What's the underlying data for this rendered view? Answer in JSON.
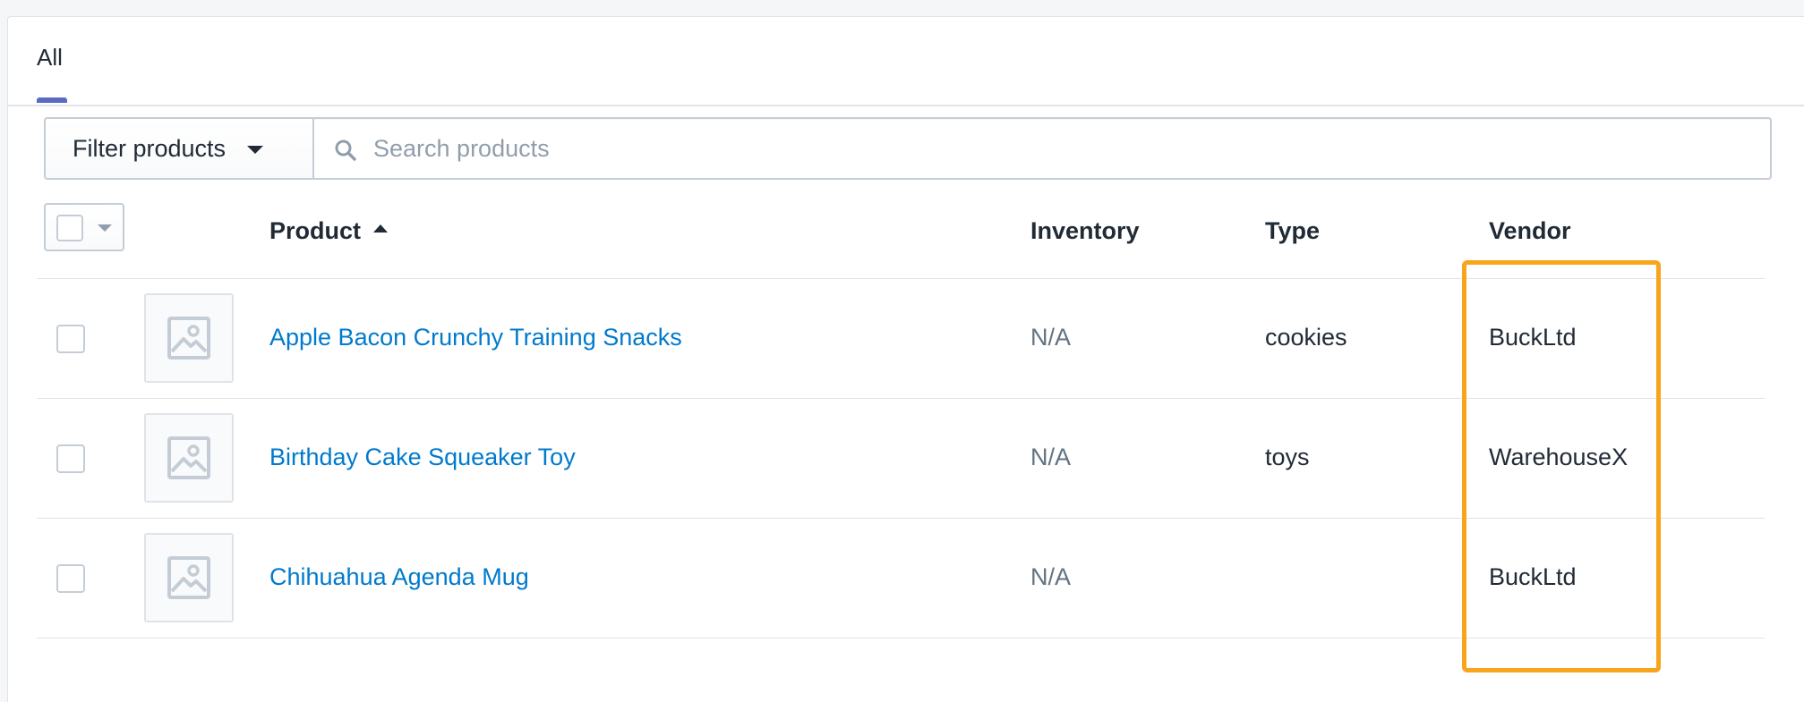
{
  "tabs": [
    {
      "label": "All",
      "selected": true
    }
  ],
  "filter": {
    "button_label": "Filter products",
    "search_placeholder": "Search products",
    "search_value": ""
  },
  "table": {
    "columns": {
      "product": "Product",
      "inventory": "Inventory",
      "type": "Type",
      "vendor": "Vendor"
    },
    "sort": {
      "column": "product",
      "direction": "ascending"
    },
    "rows": [
      {
        "product": "Apple Bacon Crunchy Training Snacks",
        "inventory": "N/A",
        "type": "cookies",
        "vendor": "BuckLtd",
        "image_icon": "image-placeholder-icon"
      },
      {
        "product": "Birthday Cake Squeaker Toy",
        "inventory": "N/A",
        "type": "toys",
        "vendor": "WarehouseX",
        "image_icon": "image-placeholder-icon"
      },
      {
        "product": "Chihuahua Agenda Mug",
        "inventory": "N/A",
        "type": "",
        "vendor": "BuckLtd",
        "image_icon": "image-placeholder-icon"
      }
    ]
  },
  "colors": {
    "accent": "#5c6ac4",
    "link": "#007ace",
    "highlight_border": "#f8a41c"
  }
}
